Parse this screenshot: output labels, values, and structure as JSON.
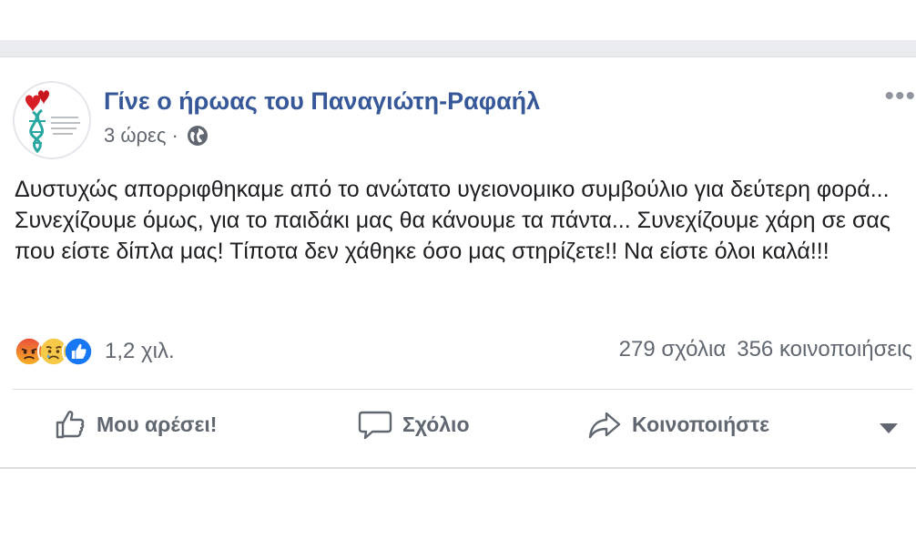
{
  "post": {
    "page_name": "Γίνε ο ήρωας του Παναγιώτη-Ραφαήλ",
    "time": "3 ώρες",
    "privacy_icon": "globe-icon",
    "more_icon": "ellipsis-icon",
    "text": "Δυστυχώς απορριφθηκαμε από το ανώτατο υγειονομικο συμβούλιο για δεύτερη φορά... Συνεχίζουμε όμως, για το παιδάκι μας θα κάνουμε τα πάντα... Συνεχίζουμε χάρη σε σας που είστε δίπλα μας! Τίποτα δεν χάθηκε όσο μας στηρίζετε!! Να είστε όλοι καλά!!!"
  },
  "avatar": {
    "logo_text": "Γίνε ο ήρωας του Παναγιώτη-Ραφαήλ"
  },
  "stats": {
    "reactions": [
      "angry-reaction-icon",
      "sad-reaction-icon",
      "like-reaction-icon"
    ],
    "reaction_count": "1,2 χιλ.",
    "comments": "279 σχόλια",
    "shares": "356 κοινοποιήσεις"
  },
  "actions": {
    "like": "Μου αρέσει!",
    "comment": "Σχόλιο",
    "share": "Κοινοποιήστε"
  },
  "colors": {
    "page_name": "#365899",
    "secondary_text": "#616770",
    "action_text": "#606770",
    "separator": "#e9ebee",
    "like_blue": "#1877f2",
    "angry_orange": "#f0623a",
    "sad_yellow": "#f7b125"
  }
}
